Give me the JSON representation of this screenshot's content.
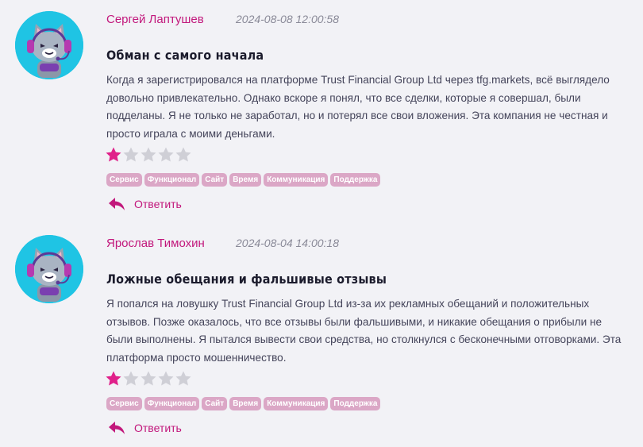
{
  "reviews": [
    {
      "author": "Сергей Лаптушев",
      "date": "2024-08-08 12:00:58",
      "title": "Обман с самого начала",
      "body": "Когда я зарегистрировался на платформе Trust Financial Group Ltd через tfg.markets, всё выглядело довольно привлекательно. Однако вскоре я понял, что все сделки, которые я совершал, были подделаны. Я не только не заработал, но и потерял все свои вложения. Эта компания не честная и просто играла с моими деньгами.",
      "rating": 1,
      "rating_max": 5,
      "tags": [
        "Сервис",
        "Функционал",
        "Сайт",
        "Время",
        "Коммуникация",
        "Поддержка"
      ],
      "reply_label": "Ответить"
    },
    {
      "author": "Ярослав Тимохин",
      "date": "2024-08-04 14:00:18",
      "title": "Ложные обещания и фальшивые отзывы",
      "body": "Я попался на ловушку Trust Financial Group Ltd из-за их рекламных обещаний и положительных отзывов. Позже оказалось, что все отзывы были фальшивыми, и никакие обещания о прибыли не были выполнены. Я пытался вывести свои средства, но столкнулся с бесконечными отговорками. Эта платформа просто мошенничество.",
      "rating": 1,
      "rating_max": 5,
      "tags": [
        "Сервис",
        "Функционал",
        "Сайт",
        "Время",
        "Коммуникация",
        "Поддержка"
      ],
      "reply_label": "Ответить"
    }
  ],
  "colors": {
    "accent": "#c2187c",
    "star_filled": "#e0208a",
    "star_empty": "#cfcfd6",
    "tag_bg": "#dba7c6",
    "avatar_bg": "#1fc4e4"
  },
  "icons": {
    "avatar": "gamer-cat-avatar-icon",
    "reply": "reply-arrow-icon",
    "star": "star-icon"
  }
}
